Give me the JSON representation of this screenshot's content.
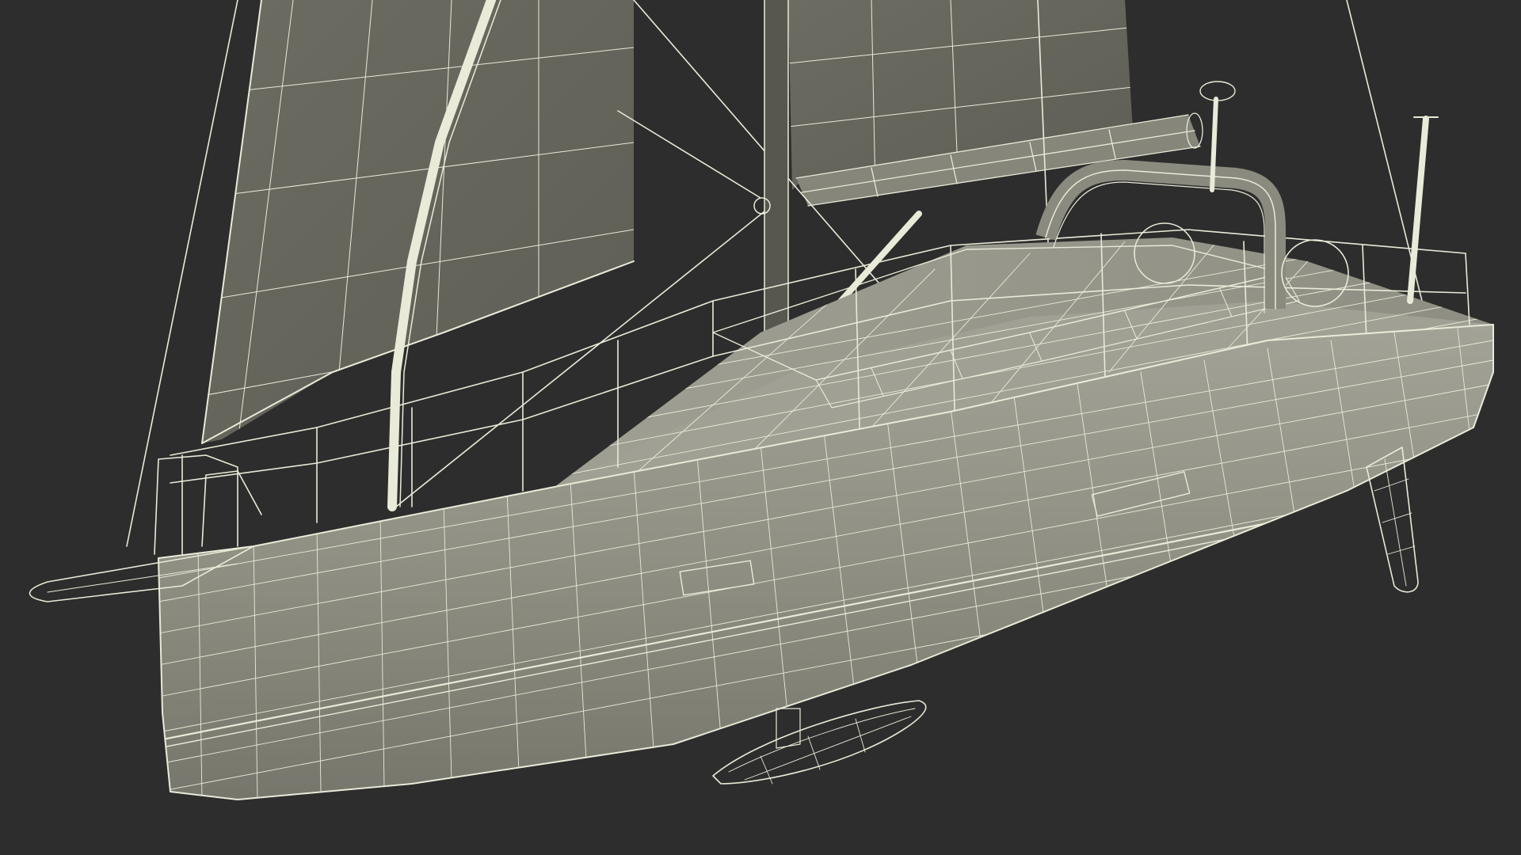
{
  "scene": {
    "subject": "sailboat-wireframe-render",
    "colors": {
      "background": "#2d2d2d",
      "hull_fill": "#8f8f83",
      "hull_shade": "#7a7a6f",
      "deck_fill": "#9c9c90",
      "sail_fill": "#6f6f65",
      "wire": "#e9ead8",
      "mast": "#55554f"
    }
  }
}
